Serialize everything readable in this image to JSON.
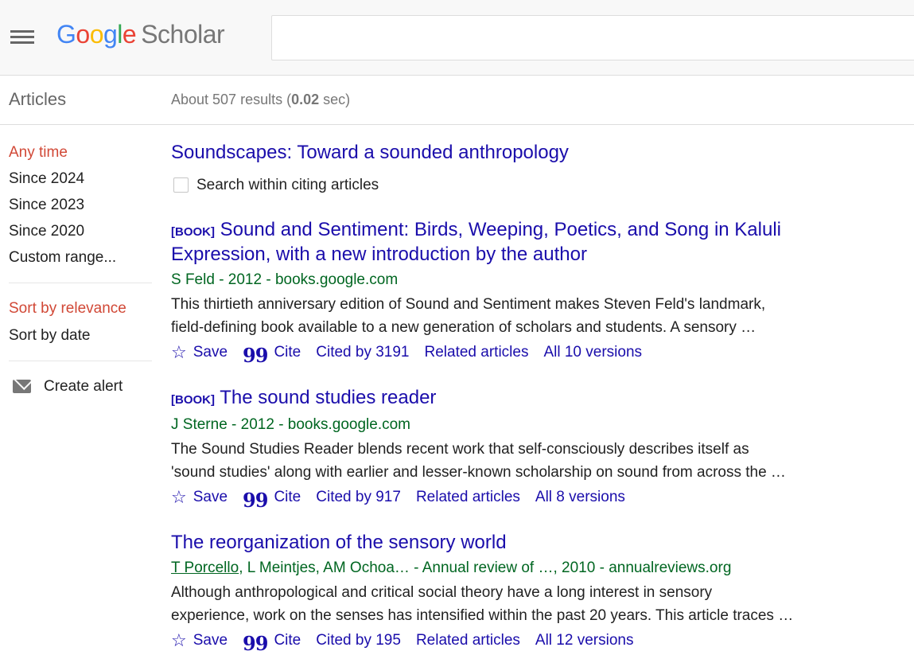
{
  "header": {
    "logo": {
      "G": "G",
      "o1": "o",
      "o2": "o",
      "g": "g",
      "l": "l",
      "e": "e",
      "suffix": "Scholar"
    },
    "search_value": ""
  },
  "subheader": {
    "section_title": "Articles",
    "stats_prefix": "About 507 results (",
    "stats_time": "0.02",
    "stats_suffix": " sec)"
  },
  "sidebar": {
    "time_filters": [
      "Any time",
      "Since 2024",
      "Since 2023",
      "Since 2020",
      "Custom range..."
    ],
    "sort_options": [
      "Sort by relevance",
      "Sort by date"
    ],
    "create_alert": "Create alert"
  },
  "top_result": {
    "title": "Soundscapes: Toward a sounded anthropology",
    "checkbox_label": "Search within citing articles"
  },
  "results": [
    {
      "tag": "[BOOK]",
      "title_line1": " Sound and Sentiment: Birds, Weeping, Poetics, and Song in Kaluli",
      "title_line2": "Expression, with a new introduction by the author",
      "meta": "S Feld - 2012 - books.google.com",
      "snippet_line1": "This thirtieth anniversary edition of Sound and Sentiment makes Steven Feld's landmark,",
      "snippet_line2": "field-defining book available to a new generation of scholars and students. A sensory …",
      "save": "Save",
      "cite": "Cite",
      "cited_by": "Cited by 3191",
      "related": "Related articles",
      "versions": "All 10 versions"
    },
    {
      "tag": "[BOOK]",
      "title_line1": " The sound studies reader",
      "meta": "J Sterne - 2012 - books.google.com",
      "snippet_line1": "The Sound Studies Reader blends recent work that self-consciously describes itself as",
      "snippet_line2": "'sound studies' along with earlier and lesser-known scholarship on sound from across the …",
      "save": "Save",
      "cite": "Cite",
      "cited_by": "Cited by 917",
      "related": "Related articles",
      "versions": "All 8 versions"
    },
    {
      "title_line1": "The reorganization of the sensory world",
      "meta_author_link": "T Porcello",
      "meta_rest": ", L Meintjes, AM Ochoa… - Annual review of …, 2010 - annualreviews.org",
      "snippet_line1": "Although anthropological and critical social theory have a long interest in sensory",
      "snippet_line2": "experience, work on the senses has intensified within the past 20 years. This article traces …",
      "save": "Save",
      "cite": "Cite",
      "cited_by": "Cited by 195",
      "related": "Related articles",
      "versions": "All 12 versions"
    }
  ],
  "icons": {
    "menu": "hamburger-icon",
    "star": "☆",
    "cite": "99",
    "mail": "mail-icon"
  }
}
